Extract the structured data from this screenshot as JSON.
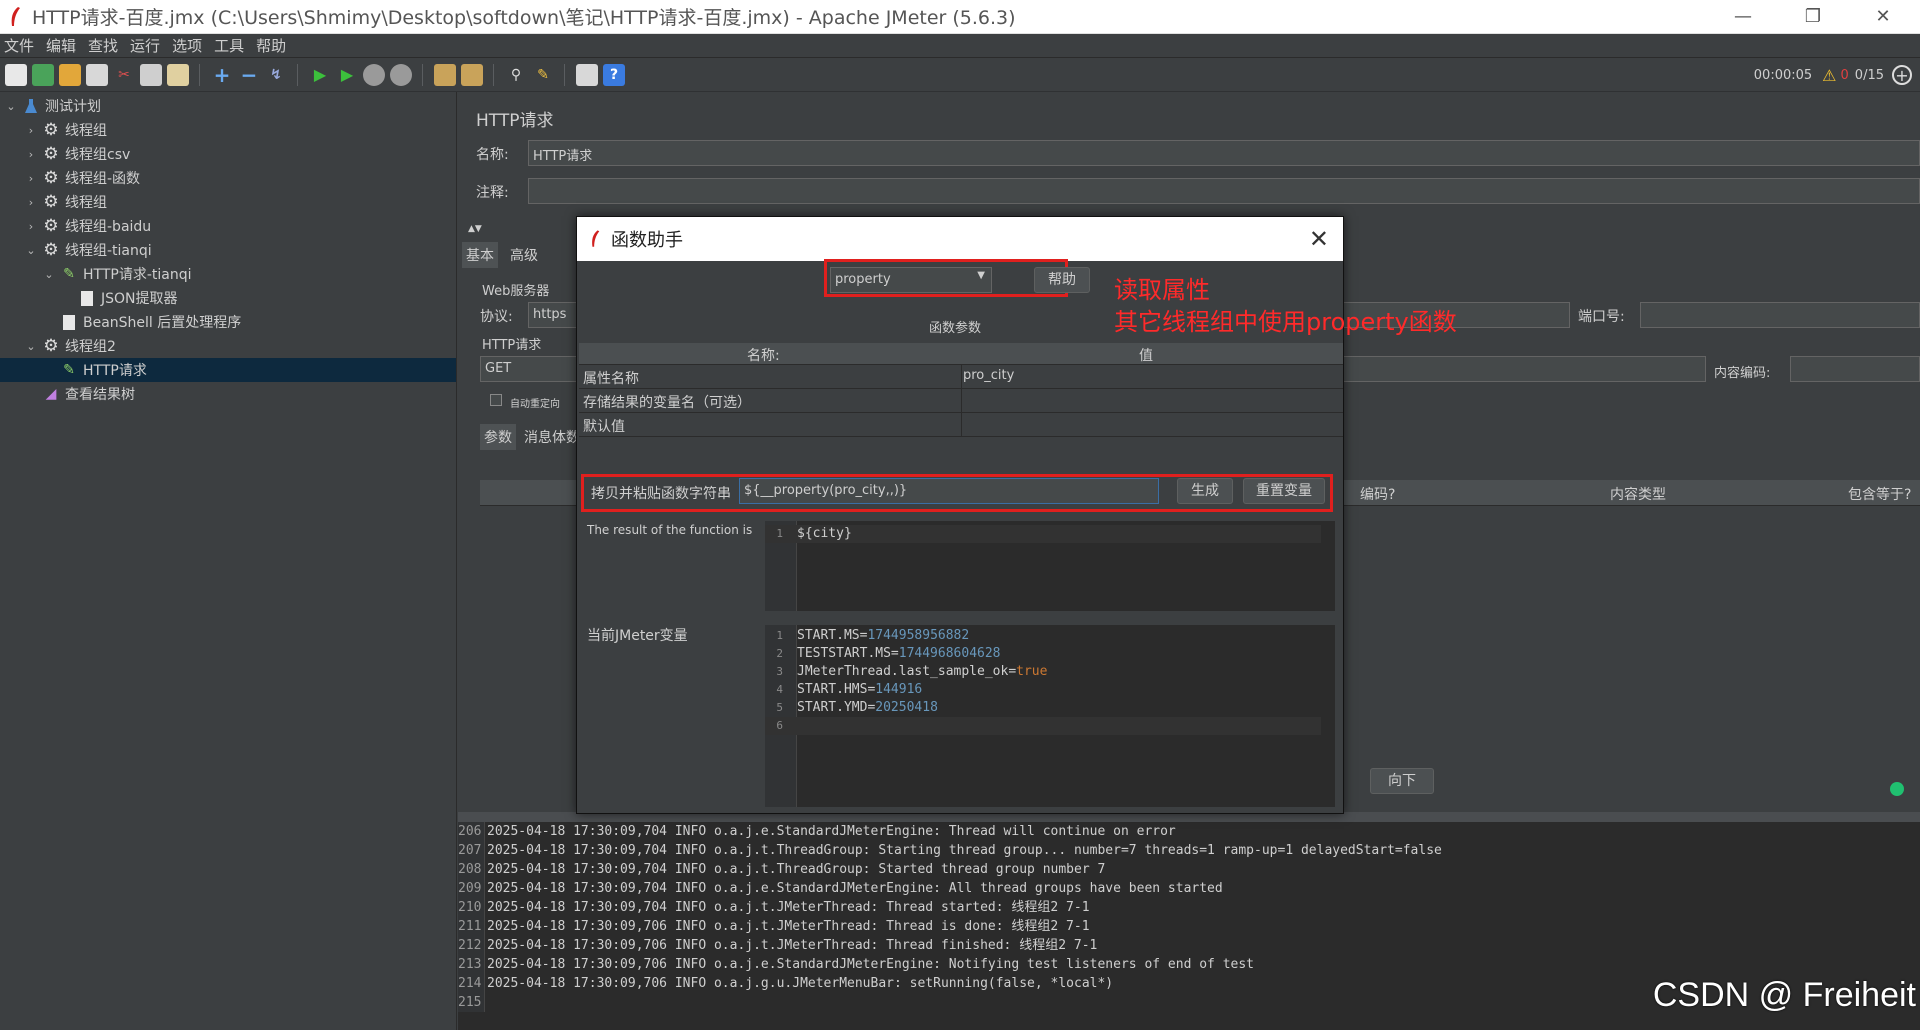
{
  "window": {
    "title": "HTTP请求-百度.jmx (C:\\Users\\Shmimy\\Desktop\\softdown\\笔记\\HTTP请求-百度.jmx) - Apache JMeter (5.6.3)",
    "min": "—",
    "max": "❐",
    "close": "✕"
  },
  "menu": [
    "文件",
    "编辑",
    "查找",
    "运行",
    "选项",
    "工具",
    "帮助"
  ],
  "toolbar": {
    "timer": "00:00:05",
    "warn_count": "0",
    "threads": "0/15"
  },
  "tree": [
    {
      "label": "测试计划",
      "arrow": "⌄",
      "icon": "flask"
    },
    {
      "label": "线程组",
      "arrow": "›",
      "icon": "gear"
    },
    {
      "label": "线程组csv",
      "arrow": "›",
      "icon": "gear"
    },
    {
      "label": "线程组-函数",
      "arrow": "›",
      "icon": "gear"
    },
    {
      "label": "线程组",
      "arrow": "›",
      "icon": "gear"
    },
    {
      "label": "线程组-baidu",
      "arrow": "›",
      "icon": "gear"
    },
    {
      "label": "线程组-tianqi",
      "arrow": "⌄",
      "icon": "gear"
    },
    {
      "label": "HTTP请求-tianqi",
      "arrow": "⌄",
      "icon": "pen"
    },
    {
      "label": "JSON提取器",
      "arrow": "",
      "icon": "doc"
    },
    {
      "label": "BeanShell 后置处理程序",
      "arrow": "",
      "icon": "doc"
    },
    {
      "label": "线程组2",
      "arrow": "⌄",
      "icon": "gear"
    },
    {
      "label": "HTTP请求",
      "arrow": "",
      "icon": "pen"
    },
    {
      "label": "查看结果树",
      "arrow": "",
      "icon": "chart"
    }
  ],
  "panel": {
    "title": "HTTP请求",
    "name_label": "名称:",
    "name_value": "HTTP请求",
    "comment_label": "注释:",
    "tab_basic": "基本",
    "tab_adv": "高级",
    "web_server": "Web服务器",
    "protocol_label": "协议:",
    "protocol_value": "https",
    "port_label": "端口号:",
    "http_request": "HTTP请求",
    "method": "GET",
    "encoding_label": "内容编码:",
    "auto_redirect": "自动重定向",
    "tab_params": "参数",
    "tab_body": "消息体数",
    "col_encode": "编码?",
    "col_ctype": "内容类型",
    "col_include": "包含等于?",
    "btn_down": "向下"
  },
  "dialog": {
    "title": "函数助手",
    "function": "property",
    "help": "帮助",
    "params_title": "函数参数",
    "col_name": "名称:",
    "col_value": "值",
    "rows": [
      {
        "name": "属性名称",
        "value": "pro_city"
      },
      {
        "name": "存储结果的变量名（可选）",
        "value": ""
      },
      {
        "name": "默认值",
        "value": ""
      }
    ],
    "copy_label": "拷贝并粘贴函数字符串",
    "func_string": "${__property(pro_city,,)}",
    "generate": "生成",
    "reset": "重置变量",
    "result_label": "The result of the function is",
    "result_line": "${city}",
    "vars_label": "当前JMeter变量",
    "vars": [
      {
        "k": "START.MS=",
        "v": "1744958956882",
        "t": "num"
      },
      {
        "k": "TESTSTART.MS=",
        "v": "1744968604628",
        "t": "num"
      },
      {
        "k": "JMeterThread.last_sample_ok=",
        "v": "true",
        "t": "kw"
      },
      {
        "k": "START.HMS=",
        "v": "144916",
        "t": "num"
      },
      {
        "k": "START.YMD=",
        "v": "20250418",
        "t": "num"
      },
      {
        "k": "",
        "v": "",
        "t": "num"
      }
    ]
  },
  "annotation": {
    "line1": "读取属性",
    "line2": "其它线程组中使用property函数"
  },
  "log": [
    {
      "n": "206",
      "t": "2025-04-18 17:30:09,704 INFO o.a.j.e.StandardJMeterEngine: Thread will continue on error"
    },
    {
      "n": "207",
      "t": "2025-04-18 17:30:09,704 INFO o.a.j.t.ThreadGroup: Starting thread group... number=7 threads=1 ramp-up=1 delayedStart=false"
    },
    {
      "n": "208",
      "t": "2025-04-18 17:30:09,704 INFO o.a.j.t.ThreadGroup: Started thread group number 7"
    },
    {
      "n": "209",
      "t": "2025-04-18 17:30:09,704 INFO o.a.j.e.StandardJMeterEngine: All thread groups have been started"
    },
    {
      "n": "210",
      "t": "2025-04-18 17:30:09,704 INFO o.a.j.t.JMeterThread: Thread started: 线程组2 7-1"
    },
    {
      "n": "211",
      "t": "2025-04-18 17:30:09,706 INFO o.a.j.t.JMeterThread: Thread is done: 线程组2 7-1"
    },
    {
      "n": "212",
      "t": "2025-04-18 17:30:09,706 INFO o.a.j.t.JMeterThread: Thread finished: 线程组2 7-1"
    },
    {
      "n": "213",
      "t": "2025-04-18 17:30:09,706 INFO o.a.j.e.StandardJMeterEngine: Notifying test listeners of end of test"
    },
    {
      "n": "214",
      "t": "2025-04-18 17:30:09,706 INFO o.a.j.g.u.JMeterMenuBar: setRunning(false, *local*)"
    },
    {
      "n": "215",
      "t": ""
    }
  ],
  "watermark": "CSDN @ Freiheit",
  "colors": {
    "selection": "#0d293e",
    "annotation": "#e0201e",
    "bg": "#3c3f41"
  }
}
